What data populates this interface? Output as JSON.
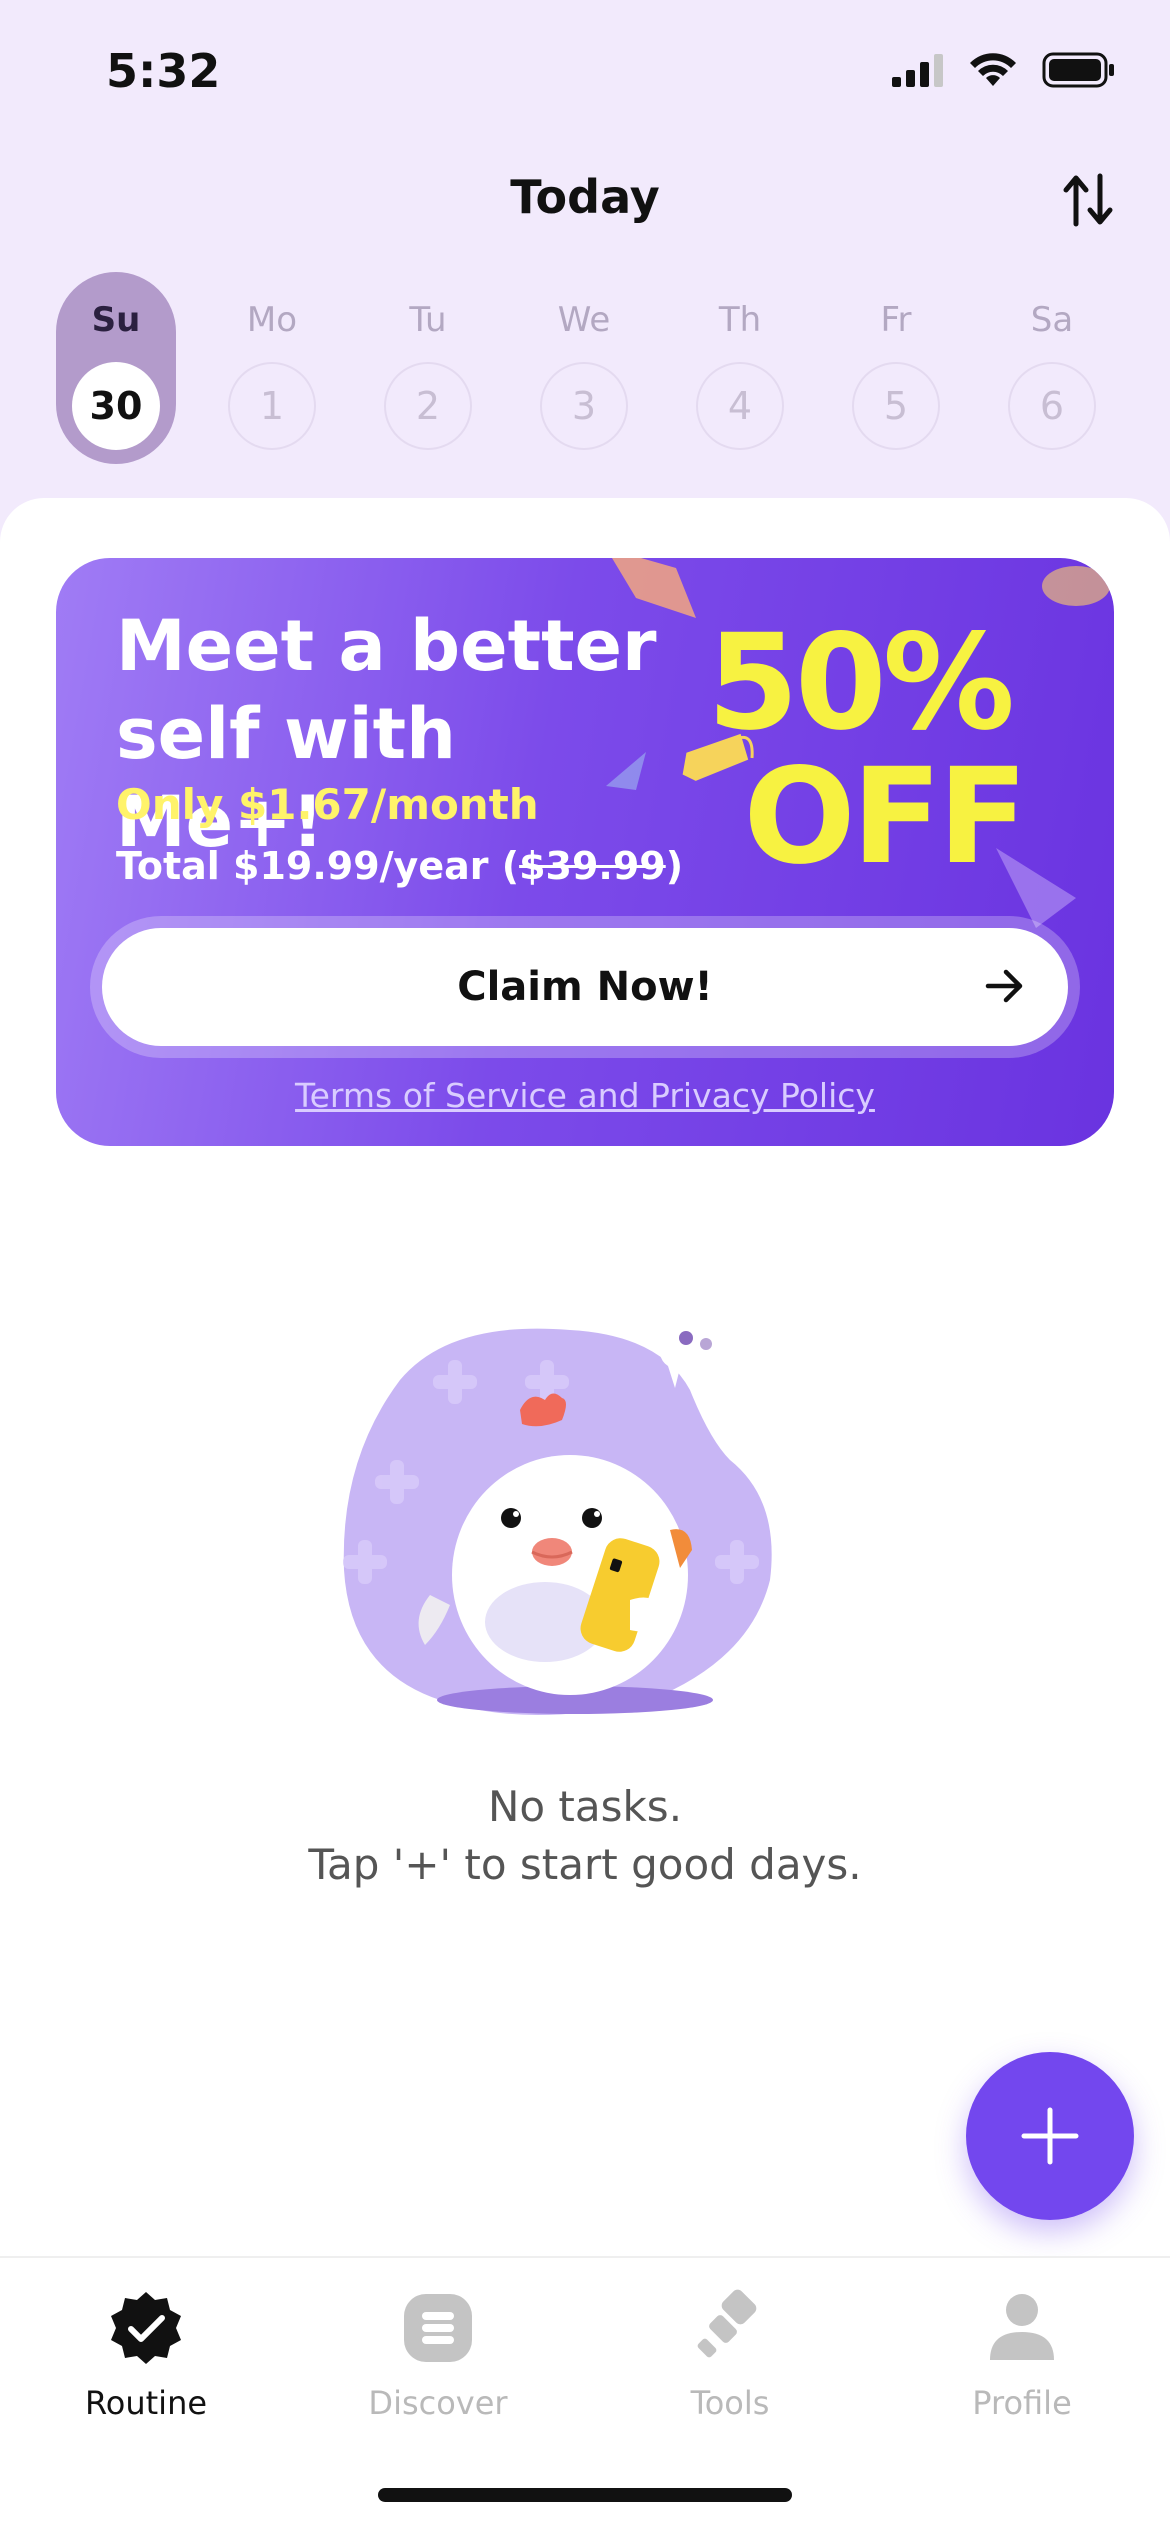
{
  "status_bar": {
    "time": "5:32",
    "icons": [
      "signal-icon",
      "wifi-icon",
      "battery-icon"
    ]
  },
  "header": {
    "title": "Today",
    "sort_icon": "sort-icon"
  },
  "week": {
    "days": [
      {
        "name": "Su",
        "number": "30",
        "selected": true
      },
      {
        "name": "Mo",
        "number": "1",
        "selected": false
      },
      {
        "name": "Tu",
        "number": "2",
        "selected": false
      },
      {
        "name": "We",
        "number": "3",
        "selected": false
      },
      {
        "name": "Th",
        "number": "4",
        "selected": false
      },
      {
        "name": "Fr",
        "number": "5",
        "selected": false
      },
      {
        "name": "Sa",
        "number": "6",
        "selected": false
      }
    ]
  },
  "promo": {
    "title": "Meet a better self with Me+!",
    "price": "Only $1.67/month",
    "total_prefix": "Total $19.99/year (",
    "total_strike": "$39.99",
    "total_suffix": ")",
    "discount_percent": "50%",
    "discount_off": "OFF",
    "button_label": "Claim Now!",
    "terms_label": "Terms of Service and Privacy Policy"
  },
  "empty_state": {
    "line1": "No tasks.",
    "line2": "Tap '+' to start good days."
  },
  "fab": {
    "icon": "plus-icon"
  },
  "tabs": [
    {
      "label": "Routine",
      "icon": "verified-badge-icon",
      "active": true
    },
    {
      "label": "Discover",
      "icon": "list-icon",
      "active": false
    },
    {
      "label": "Tools",
      "icon": "tool-icon",
      "active": false
    },
    {
      "label": "Profile",
      "icon": "person-icon",
      "active": false
    }
  ],
  "colors": {
    "background": "#F2EAFC",
    "accent": "#7347EE",
    "promo_highlight": "#F7F241"
  }
}
